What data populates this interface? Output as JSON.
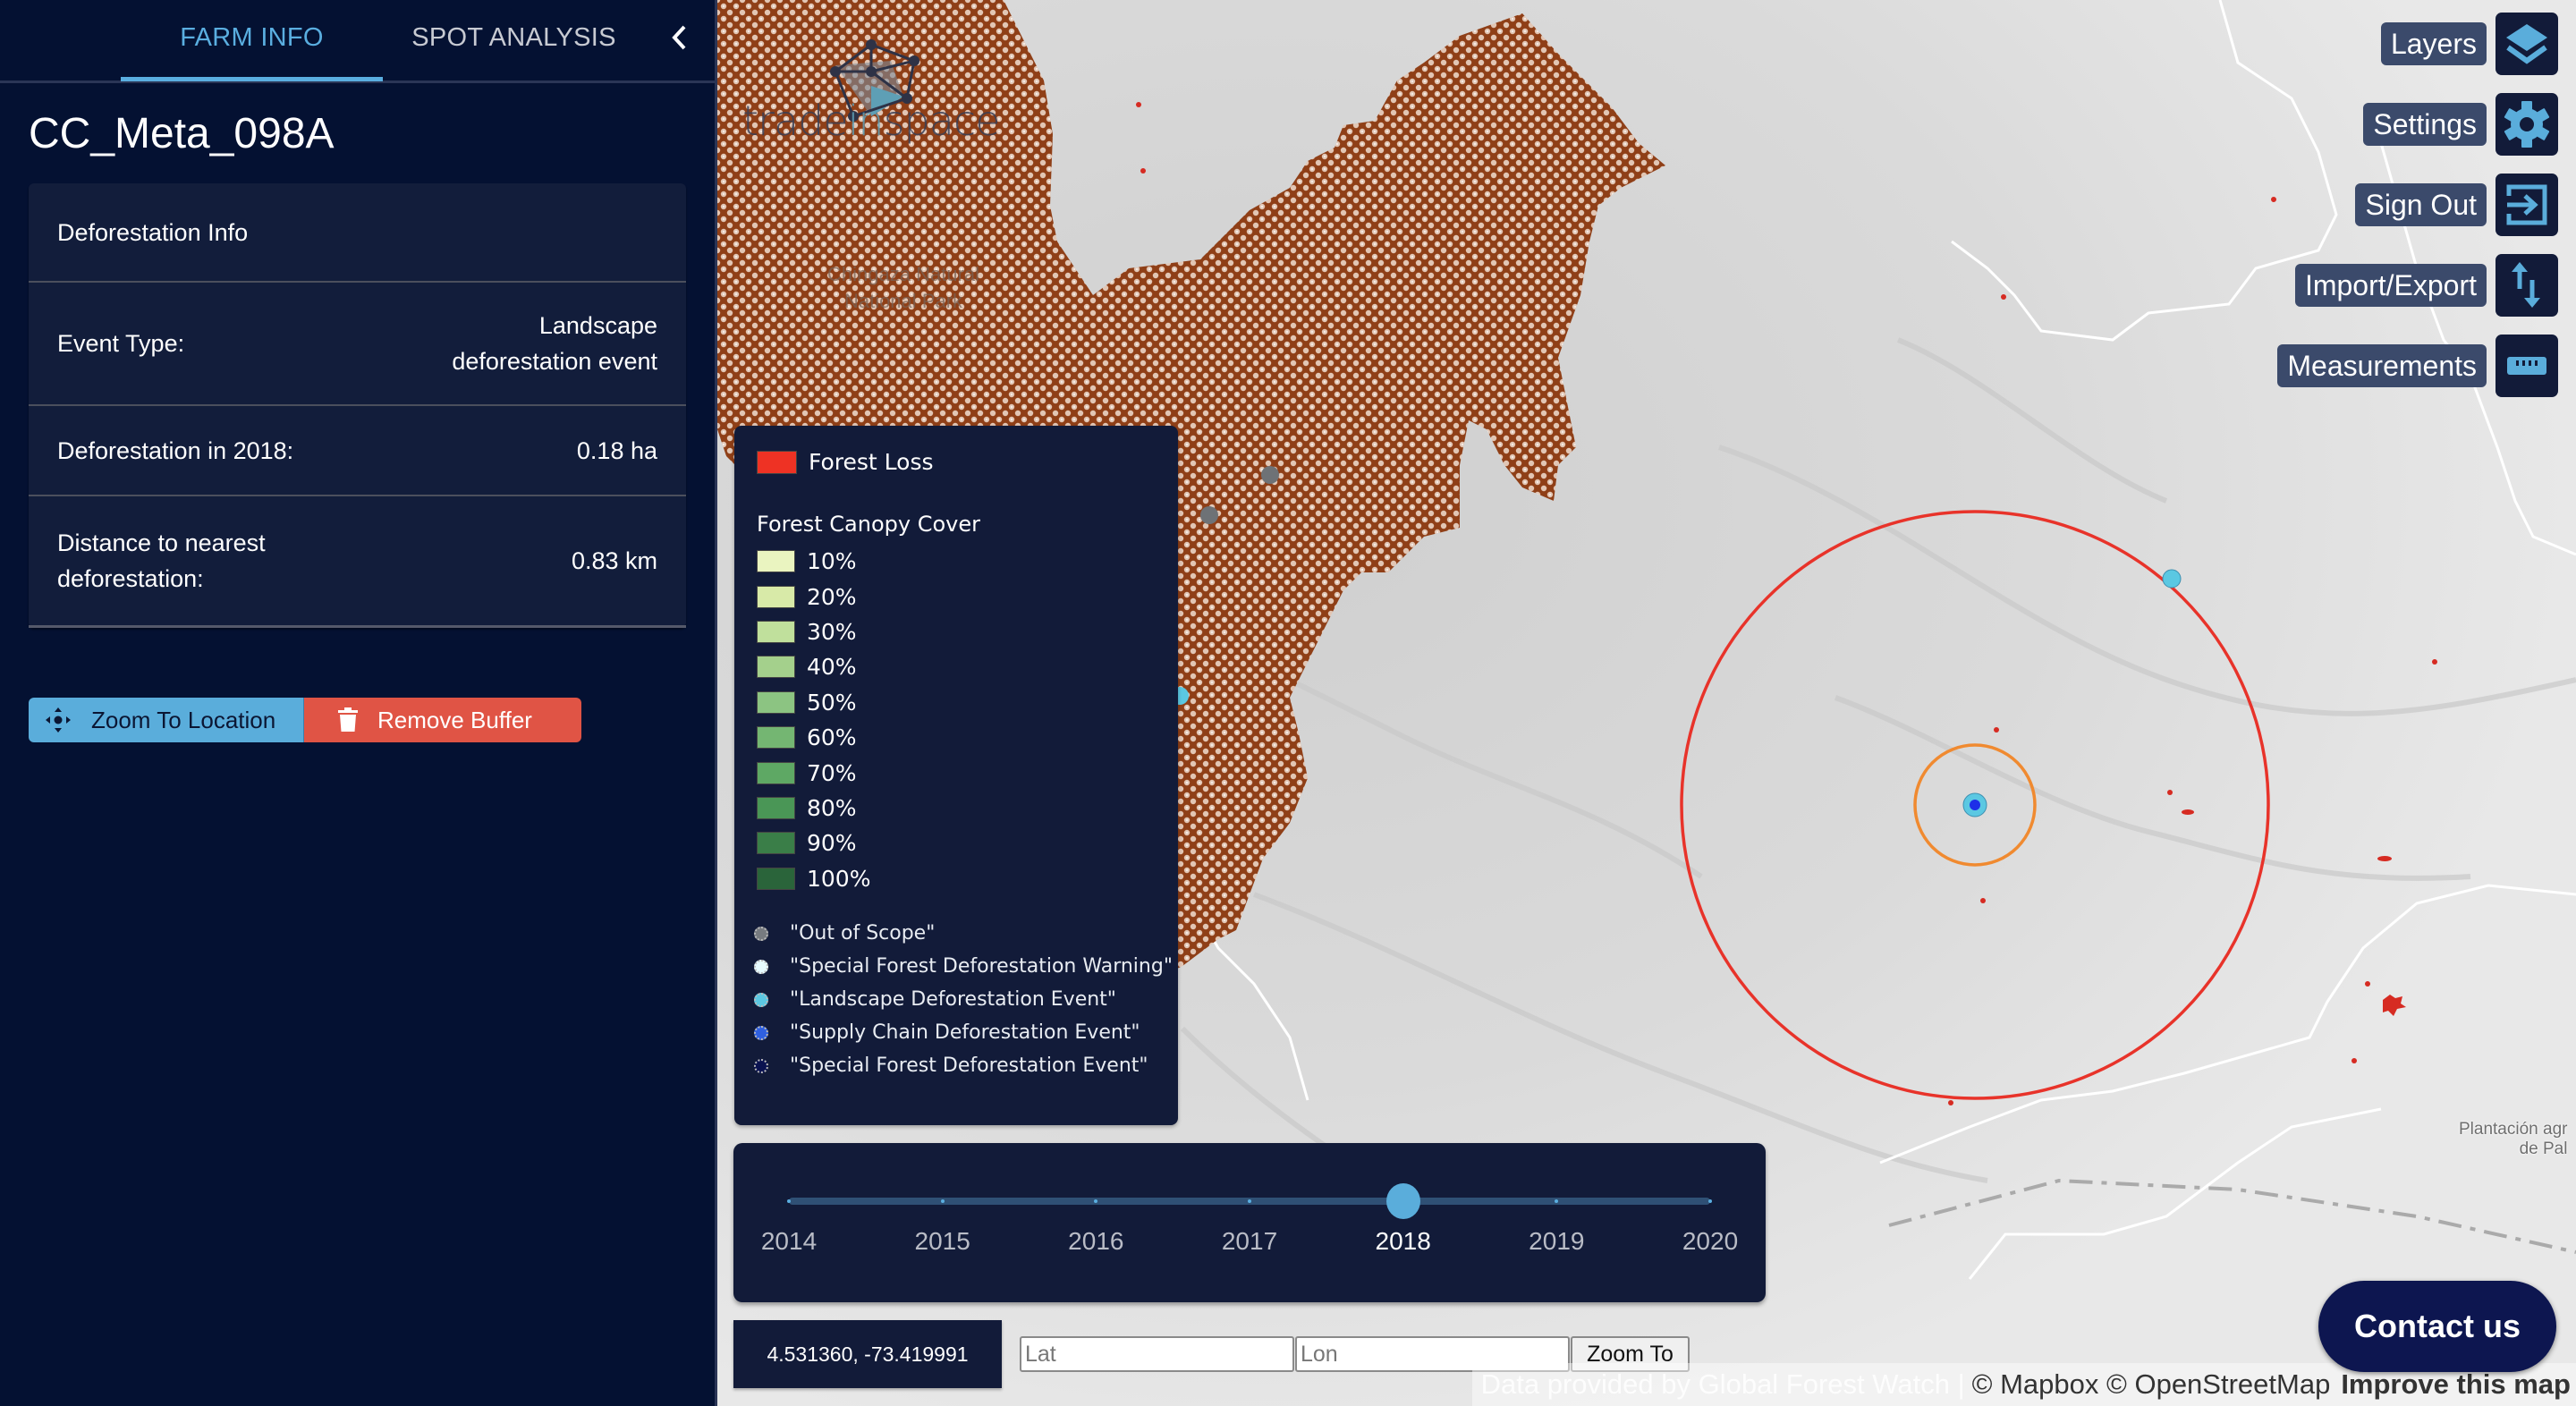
{
  "sidebar": {
    "tabs": [
      {
        "label": "FARM INFO",
        "active": true
      },
      {
        "label": "SPOT ANALYSIS",
        "active": false
      }
    ],
    "collapse_icon": "chevron-left-icon",
    "farm_name": "CC_Meta_098A",
    "info": {
      "header": "Deforestation Info",
      "rows": [
        {
          "label": "Event Type:",
          "value_line1": "Landscape",
          "value_line2": "deforestation event"
        },
        {
          "label": "Deforestation in 2018:",
          "value": "0.18 ha"
        },
        {
          "label_line1": "Distance to nearest",
          "label_line2": "deforestation:",
          "value": "0.83 km"
        }
      ]
    },
    "buttons": {
      "zoom_to_location": {
        "label": "Zoom To Location",
        "icon": "move-arrows-icon",
        "color": "#5aaddb"
      },
      "remove_buffer": {
        "label": "Remove Buffer",
        "icon": "trash-icon",
        "color": "#e05445"
      }
    }
  },
  "map": {
    "logo": {
      "text_before": "trade",
      "text_in": "in",
      "text_after": "space"
    },
    "park_label": {
      "line1": "Chingaza Natural",
      "line2": "National Park"
    },
    "place_label": {
      "line1": "Plantación agr",
      "line2": "de Pal"
    },
    "legend": {
      "forest_loss": {
        "label": "Forest Loss",
        "color": "#ee3224"
      },
      "canopy_title": "Forest Canopy Cover",
      "canopy": [
        {
          "label": "10%",
          "color": "#eaf4c0"
        },
        {
          "label": "20%",
          "color": "#d8eaa8"
        },
        {
          "label": "30%",
          "color": "#c0e09c"
        },
        {
          "label": "40%",
          "color": "#a4d08c"
        },
        {
          "label": "50%",
          "color": "#8cc482"
        },
        {
          "label": "60%",
          "color": "#74b672"
        },
        {
          "label": "70%",
          "color": "#5ea864"
        },
        {
          "label": "80%",
          "color": "#4a9656"
        },
        {
          "label": "90%",
          "color": "#3a7e48"
        },
        {
          "label": "100%",
          "color": "#2a643a"
        }
      ],
      "events": [
        {
          "label": "\"Out of Scope\"",
          "color": "#777b80"
        },
        {
          "label": "\"Special Forest Deforestation Warning\"",
          "color": "#e6fbff"
        },
        {
          "label": "\"Landscape Deforestation Event\"",
          "color": "#5bc8e2"
        },
        {
          "label": "\"Supply Chain Deforestation Event\"",
          "color": "#2f60e0"
        },
        {
          "label": "\"Special Forest Deforestation Event\"",
          "color": "#0a1250"
        }
      ]
    },
    "timeline": {
      "years": [
        "2014",
        "2015",
        "2016",
        "2017",
        "2018",
        "2019",
        "2020"
      ],
      "selected": "2018",
      "selected_index": 4
    },
    "coordinates": "4.531360, -73.419991",
    "lat_placeholder": "Lat",
    "lon_placeholder": "Lon",
    "zoom_to_label": "Zoom To",
    "attribution": {
      "gfw": "Data provided by Global Forest Watch |",
      "mapbox": "© Mapbox © OpenStreetMap",
      "improve": "Improve this map"
    },
    "contact_label": "Contact us",
    "controls": [
      {
        "label": "Layers",
        "icon": "layers-icon"
      },
      {
        "label": "Settings",
        "icon": "gear-icon"
      },
      {
        "label": "Sign Out",
        "icon": "sign-out-icon"
      },
      {
        "label": "Import/Export",
        "icon": "import-export-icon"
      },
      {
        "label": "Measurements",
        "icon": "ruler-icon"
      }
    ],
    "colors": {
      "buffer_outer": "#e8332a",
      "buffer_inner": "#f08a30",
      "protected_area": "#8f3f17",
      "accent": "#5aaee0"
    }
  }
}
